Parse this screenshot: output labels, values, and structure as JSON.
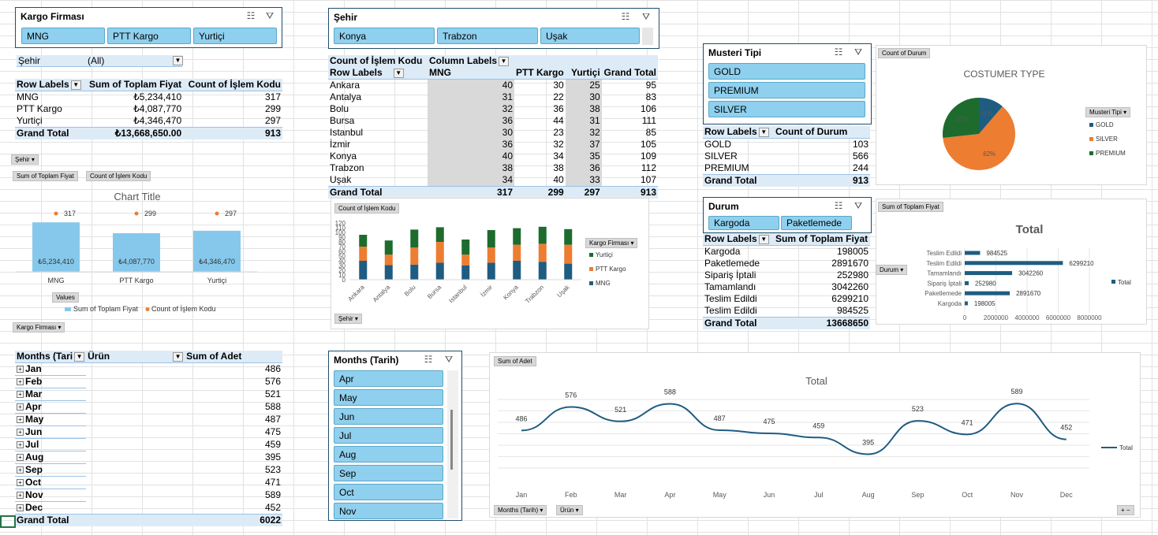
{
  "colors": {
    "accent_blue": "#8fd0ee",
    "header_blue": "#ddebf7",
    "mng": "#1f5c82",
    "ptt": "#ed7d31",
    "yurtici": "#1e6b2e",
    "bar_light": "#86c8ec",
    "orange_dot": "#ed7d31",
    "line_blue": "#1f5c82"
  },
  "icons": [
    "multi-select-icon",
    "clear-filter-icon",
    "dropdown-arrow-icon",
    "expand-plus-icon"
  ],
  "slicer_kargo": {
    "title": "Kargo Firması",
    "items": [
      "MNG",
      "PTT Kargo",
      "Yurtiçi"
    ]
  },
  "slicer_sehir": {
    "title": "Şehir",
    "items": [
      "Konya",
      "Trabzon",
      "Uşak"
    ]
  },
  "slicer_musteri": {
    "title": "Musteri  Tipi",
    "items": [
      "GOLD",
      "PREMIUM",
      "SILVER"
    ]
  },
  "slicer_durum": {
    "title": "Durum",
    "items": [
      "Kargoda",
      "Paketlemede"
    ]
  },
  "slicer_months": {
    "title": "Months (Tarih)",
    "items": [
      "Apr",
      "May",
      "Jun",
      "Jul",
      "Aug",
      "Sep",
      "Oct",
      "Nov"
    ]
  },
  "filter_sehir": {
    "label": "Şehir",
    "value": "(All)"
  },
  "pivot1": {
    "headers": [
      "Row Labels",
      "Sum of Toplam Fiyat",
      "Count of İşlem Kodu"
    ],
    "rows": [
      [
        "MNG",
        "₺5,234,410",
        "317"
      ],
      [
        "PTT Kargo",
        "₺4,087,770",
        "299"
      ],
      [
        "Yurtiçi",
        "₺4,346,470",
        "297"
      ]
    ],
    "total": [
      "Grand Total",
      "₺13,668,650.00",
      "913"
    ]
  },
  "pivot2": {
    "corner": "Count of İşlem Kodu",
    "column_labels": "Column Labels",
    "row_labels": "Row Labels",
    "columns": [
      "MNG",
      "PTT Kargo",
      "Yurtiçi",
      "Grand Total"
    ],
    "rows": [
      [
        "Ankara",
        "40",
        "30",
        "25",
        "95"
      ],
      [
        "Antalya",
        "31",
        "22",
        "30",
        "83"
      ],
      [
        "Bolu",
        "32",
        "36",
        "38",
        "106"
      ],
      [
        "Bursa",
        "36",
        "44",
        "31",
        "111"
      ],
      [
        "Istanbul",
        "30",
        "23",
        "32",
        "85"
      ],
      [
        "İzmir",
        "36",
        "32",
        "37",
        "105"
      ],
      [
        "Konya",
        "40",
        "34",
        "35",
        "109"
      ],
      [
        "Trabzon",
        "38",
        "38",
        "36",
        "112"
      ],
      [
        "Uşak",
        "34",
        "40",
        "33",
        "107"
      ]
    ],
    "total": [
      "Grand Total",
      "317",
      "299",
      "297",
      "913"
    ]
  },
  "pivot3": {
    "headers": [
      "Row Labels",
      "Count of Durum"
    ],
    "rows": [
      [
        "GOLD",
        "103"
      ],
      [
        "SILVER",
        "566"
      ],
      [
        "PREMIUM",
        "244"
      ]
    ],
    "total": [
      "Grand Total",
      "913"
    ]
  },
  "pivot4": {
    "headers": [
      "Row Labels",
      "Sum of Toplam Fiyat"
    ],
    "rows": [
      [
        "Kargoda",
        "198005"
      ],
      [
        "Paketlemede",
        "2891670"
      ],
      [
        "Sipariş İptali",
        "252980"
      ],
      [
        "Tamamlandı",
        "3042260"
      ],
      [
        "Teslim Edildi",
        "6299210"
      ],
      [
        "Teslim Edildi",
        "984525"
      ]
    ],
    "total": [
      "Grand Total",
      "13668650"
    ]
  },
  "pivot5": {
    "headers": [
      "Months (Tari",
      "Ürün",
      "Sum of Adet"
    ],
    "rows": [
      [
        "Jan",
        "486"
      ],
      [
        "Feb",
        "576"
      ],
      [
        "Mar",
        "521"
      ],
      [
        "Apr",
        "588"
      ],
      [
        "May",
        "487"
      ],
      [
        "Jun",
        "475"
      ],
      [
        "Jul",
        "459"
      ],
      [
        "Aug",
        "395"
      ],
      [
        "Sep",
        "523"
      ],
      [
        "Oct",
        "471"
      ],
      [
        "Nov",
        "589"
      ],
      [
        "Dec",
        "452"
      ]
    ],
    "total": [
      "Grand Total",
      "6022"
    ]
  },
  "chart1_buttons": {
    "filter": "Şehir",
    "sum": "Sum of Toplam Fiyat",
    "count": "Count of İşlem Kodu",
    "values": "Values",
    "axis": "Kargo Firması"
  },
  "chart2_buttons": {
    "value": "Count of İşlem Kodu",
    "axis": "Şehir",
    "legend": "Kargo Firması"
  },
  "chart3_buttons": {
    "value": "Count of Durum",
    "legend": "Musteri  Tipi"
  },
  "chart4_buttons": {
    "value": "Sum of Toplam Fiyat",
    "axis": "Durum"
  },
  "chart5_buttons": {
    "value": "Sum of Adet",
    "axis1": "Months (Tarih)",
    "axis2": "Ürün",
    "zoom": "+ −"
  },
  "chart_data": [
    {
      "type": "bar",
      "title": "Chart Title",
      "categories": [
        "MNG",
        "PTT Kargo",
        "Yurtiçi"
      ],
      "series": [
        {
          "name": "Sum of Toplam Fiyat",
          "values": [
            5234410,
            4087770,
            4346470
          ],
          "labels": [
            "₺5,234,410",
            "₺4,087,770",
            "₺4,346,470"
          ]
        },
        {
          "name": "Count of İşlem Kodu",
          "values": [
            317,
            299,
            297
          ],
          "labels": [
            "317",
            "299",
            "297"
          ]
        }
      ],
      "legend": "bottom"
    },
    {
      "type": "bar",
      "stacked": true,
      "title": "",
      "categories": [
        "Ankara",
        "Antalya",
        "Bolu",
        "Bursa",
        "Istanbul",
        "İzmir",
        "Konya",
        "Trabzon",
        "Uşak"
      ],
      "series": [
        {
          "name": "MNG",
          "values": [
            40,
            31,
            32,
            36,
            30,
            36,
            40,
            38,
            34
          ]
        },
        {
          "name": "PTT Kargo",
          "values": [
            30,
            22,
            36,
            44,
            23,
            32,
            34,
            38,
            40
          ]
        },
        {
          "name": "Yurtiçi",
          "values": [
            25,
            30,
            38,
            31,
            32,
            37,
            35,
            36,
            33
          ]
        }
      ],
      "yticks": [
        "0",
        "10",
        "20",
        "30",
        "40",
        "50",
        "60",
        "70",
        "80",
        "90",
        "100",
        "110",
        "120"
      ],
      "ylim": [
        0,
        120
      ],
      "legend_order": [
        "Yurtiçi",
        "PTT Kargo",
        "MNG"
      ],
      "legend": "right"
    },
    {
      "type": "pie",
      "title": "COSTUMER   TYPE",
      "slices": [
        {
          "name": "GOLD",
          "value": 103,
          "label": "11%"
        },
        {
          "name": "SILVER",
          "value": 566,
          "label": "62%"
        },
        {
          "name": "PREMIUM",
          "value": 244,
          "label": "27%"
        }
      ],
      "legend": "right"
    },
    {
      "type": "bar",
      "horizontal": true,
      "title": "Total",
      "categories": [
        "Teslim Edildi",
        "Teslim Edildi",
        "Tamamlandı",
        "Sipariş İptali",
        "Paketlemede",
        "Kargoda"
      ],
      "values": [
        984525,
        6299210,
        3042260,
        252980,
        2891670,
        198005
      ],
      "labels": [
        "984525",
        "6299210",
        "3042260",
        "252980",
        "2891670",
        "198005"
      ],
      "xticks": [
        "0",
        "2000000",
        "4000000",
        "6000000",
        "8000000"
      ],
      "xlim": [
        0,
        8000000
      ],
      "series_name": "Total",
      "legend": "right"
    },
    {
      "type": "line",
      "title": "Total",
      "categories": [
        "Jan",
        "Feb",
        "Mar",
        "Apr",
        "May",
        "Jun",
        "Jul",
        "Aug",
        "Sep",
        "Oct",
        "Nov",
        "Dec"
      ],
      "values": [
        486,
        576,
        521,
        588,
        487,
        475,
        459,
        395,
        523,
        471,
        589,
        452
      ],
      "series_name": "Total",
      "legend": "right"
    }
  ]
}
